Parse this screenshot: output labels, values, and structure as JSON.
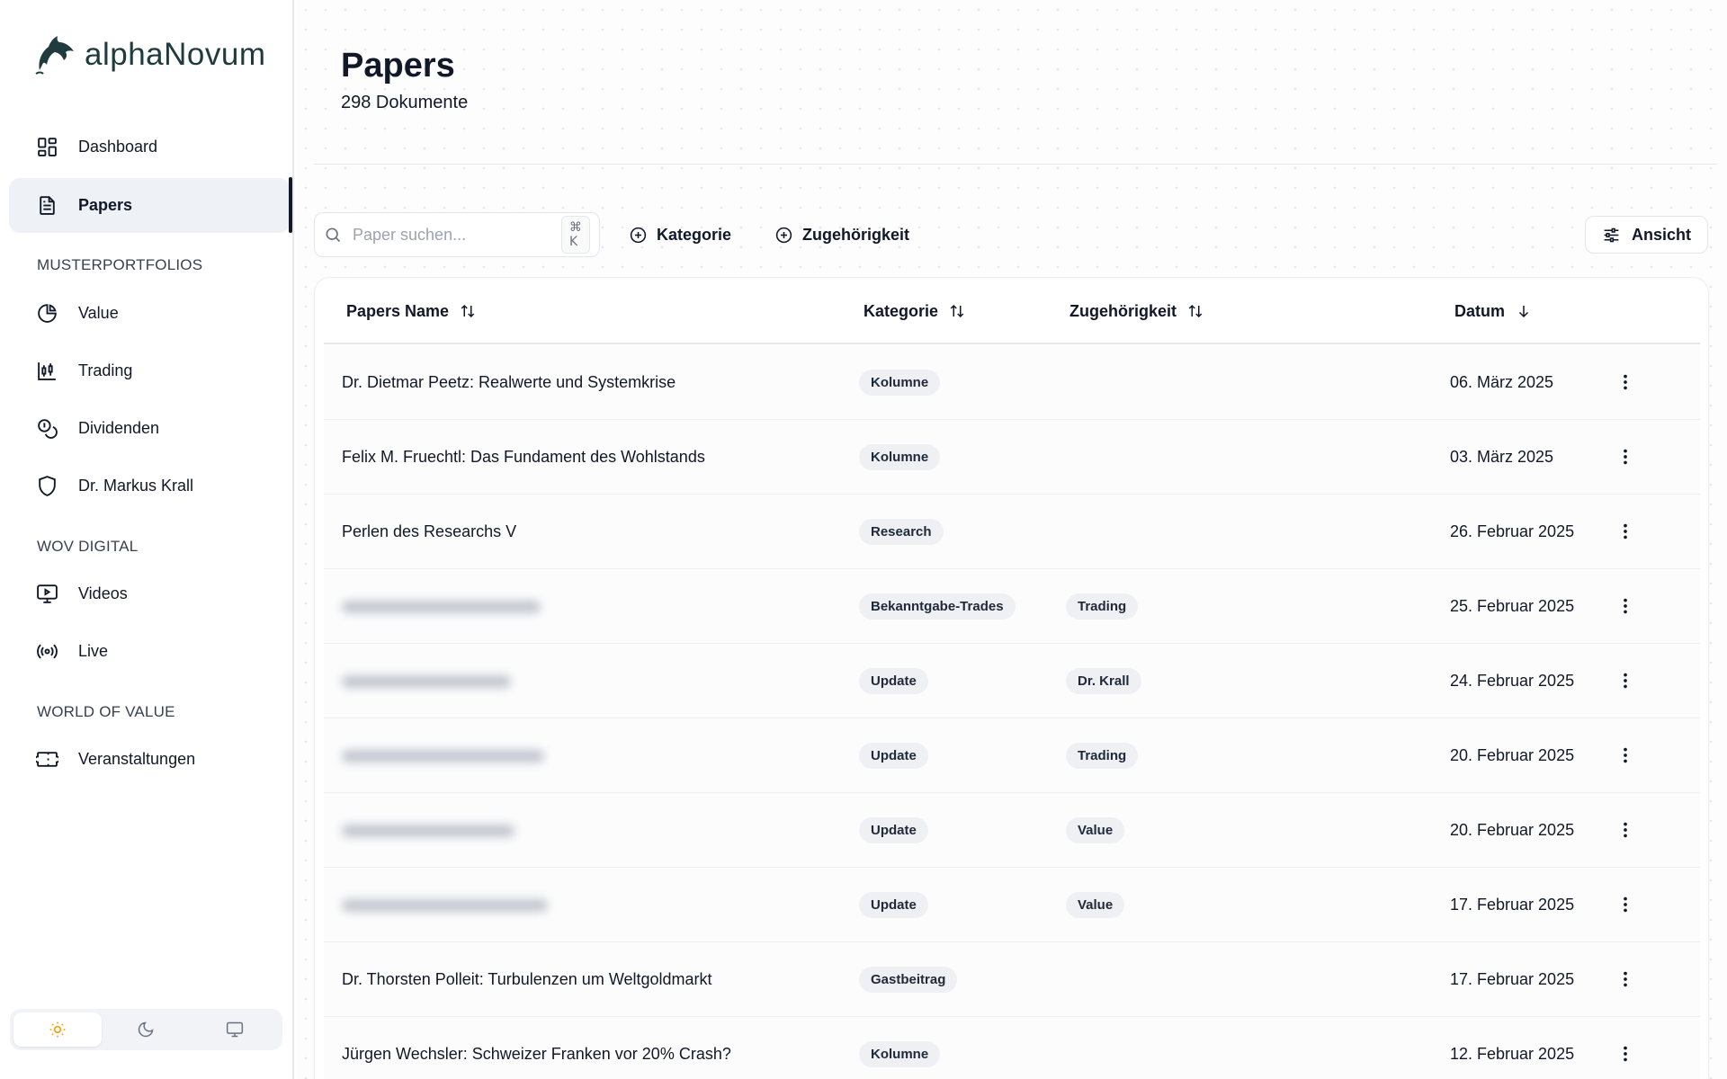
{
  "app": {
    "logo_text": "alphaNovum"
  },
  "sidebar": {
    "nav": [
      {
        "label": "Dashboard",
        "icon": "dashboard-grid-icon"
      },
      {
        "label": "Papers",
        "icon": "document-icon",
        "active": true
      }
    ],
    "sections": [
      {
        "title": "MUSTERPORTFOLIOS",
        "items": [
          {
            "label": "Value",
            "icon": "pie-chart-icon"
          },
          {
            "label": "Trading",
            "icon": "candlestick-chart-icon"
          },
          {
            "label": "Dividenden",
            "icon": "coins-icon"
          },
          {
            "label": "Dr. Markus Krall",
            "icon": "shield-icon"
          }
        ]
      },
      {
        "title": "WOV DIGITAL",
        "items": [
          {
            "label": "Videos",
            "icon": "monitor-play-icon"
          },
          {
            "label": "Live",
            "icon": "broadcast-icon"
          }
        ]
      },
      {
        "title": "WORLD OF VALUE",
        "items": [
          {
            "label": "Veranstaltungen",
            "icon": "ticket-icon"
          }
        ]
      }
    ],
    "theme": {
      "options": [
        "light",
        "dark",
        "system"
      ],
      "selected": "light"
    }
  },
  "page": {
    "title": "Papers",
    "subtitle": "298 Dokumente"
  },
  "toolbar": {
    "search_placeholder": "Paper suchen...",
    "search_value": "",
    "search_shortcut": "⌘ K",
    "filter_category": "Kategorie",
    "filter_affiliation": "Zugehörigkeit",
    "view_button": "Ansicht"
  },
  "table": {
    "columns": [
      {
        "label": "Papers Name",
        "sort": "sortable"
      },
      {
        "label": "Kategorie",
        "sort": "sortable"
      },
      {
        "label": "Zugehörigkeit",
        "sort": "sortable"
      },
      {
        "label": "Datum",
        "sort": "descending"
      }
    ],
    "rows": [
      {
        "name": "Dr. Dietmar Peetz: Realwerte und Systemkrise",
        "blurred": false,
        "category": "Kolumne",
        "affiliation": "",
        "date": "06. März 2025"
      },
      {
        "name": "Felix M. Fruechtl: Das Fundament des Wohlstands",
        "blurred": false,
        "category": "Kolumne",
        "affiliation": "",
        "date": "03. März 2025"
      },
      {
        "name": "Perlen des Researchs V",
        "blurred": false,
        "category": "Research",
        "affiliation": "",
        "date": "26. Februar 2025"
      },
      {
        "name": "",
        "blurred": true,
        "category": "Bekanntgabe-Trades",
        "affiliation": "Trading",
        "date": "25. Februar 2025"
      },
      {
        "name": "",
        "blurred": true,
        "category": "Update",
        "affiliation": "Dr. Krall",
        "date": "24. Februar 2025"
      },
      {
        "name": "",
        "blurred": true,
        "category": "Update",
        "affiliation": "Trading",
        "date": "20. Februar 2025"
      },
      {
        "name": "",
        "blurred": true,
        "category": "Update",
        "affiliation": "Value",
        "date": "20. Februar 2025"
      },
      {
        "name": "",
        "blurred": true,
        "category": "Update",
        "affiliation": "Value",
        "date": "17. Februar 2025"
      },
      {
        "name": "Dr. Thorsten Polleit: Turbulenzen um Weltgoldmarkt",
        "blurred": false,
        "category": "Gastbeitrag",
        "affiliation": "",
        "date": "17. Februar 2025"
      },
      {
        "name": "Jürgen Wechsler: Schweizer Franken vor 20% Crash?",
        "blurred": false,
        "category": "Kolumne",
        "affiliation": "",
        "date": "12. Februar 2025"
      }
    ]
  }
}
